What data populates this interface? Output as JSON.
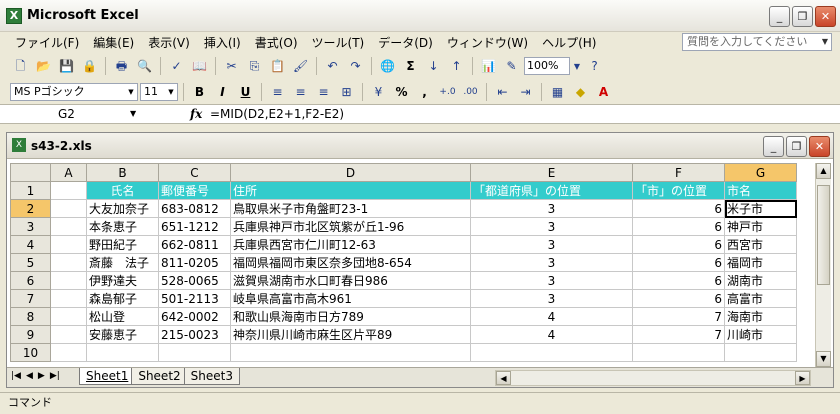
{
  "app": {
    "title": "Microsoft Excel",
    "icon": "excel-icon"
  },
  "menu": [
    "ファイル(F)",
    "編集(E)",
    "表示(V)",
    "挿入(I)",
    "書式(O)",
    "ツール(T)",
    "データ(D)",
    "ウィンドウ(W)",
    "ヘルプ(H)"
  ],
  "help_box": {
    "placeholder": "質問を入力してください"
  },
  "toolbar": {
    "zoom": "100%",
    "font": "MS Pゴシック",
    "size": "11",
    "bold": "B",
    "italic": "I",
    "underline": "U",
    "percent": "%",
    "comma": ",",
    "sigma": "Σ"
  },
  "formula": {
    "namebox": "G2",
    "fx": "fx",
    "value": "=MID(D2,E2+1,F2-E2)"
  },
  "workbook": {
    "name": "s43-2.xls"
  },
  "columns": [
    "A",
    "B",
    "C",
    "D",
    "E",
    "F",
    "G"
  ],
  "header_row": {
    "b": "氏名",
    "c": "郵便番号",
    "d": "住所",
    "e": "「都道府県」の位置",
    "f": "「市」の位置",
    "g": "市名"
  },
  "rows": [
    {
      "n": "2",
      "b": "大友加奈子",
      "c": "683-0812",
      "d": "鳥取県米子市角盤町23-1",
      "e": "3",
      "f": "6",
      "g": "米子市"
    },
    {
      "n": "3",
      "b": "本条恵子",
      "c": "651-1212",
      "d": "兵庫県神戸市北区筑紫が丘1-96",
      "e": "3",
      "f": "6",
      "g": "神戸市"
    },
    {
      "n": "4",
      "b": "野田紀子",
      "c": "662-0811",
      "d": "兵庫県西宮市仁川町12-63",
      "e": "3",
      "f": "6",
      "g": "西宮市"
    },
    {
      "n": "5",
      "b": "斎藤　法子",
      "c": "811-0205",
      "d": "福岡県福岡市東区奈多団地8-654",
      "e": "3",
      "f": "6",
      "g": "福岡市"
    },
    {
      "n": "6",
      "b": "伊野達夫",
      "c": "528-0065",
      "d": "滋賀県湖南市水口町春日986",
      "e": "3",
      "f": "6",
      "g": "湖南市"
    },
    {
      "n": "7",
      "b": "森島郁子",
      "c": "501-2113",
      "d": "岐阜県高富市高木961",
      "e": "3",
      "f": "6",
      "g": "高富市"
    },
    {
      "n": "8",
      "b": "松山登",
      "c": "642-0002",
      "d": "和歌山県海南市日方789",
      "e": "4",
      "f": "7",
      "g": "海南市"
    },
    {
      "n": "9",
      "b": "安藤恵子",
      "c": "215-0023",
      "d": "神奈川県川崎市麻生区片平89",
      "e": "4",
      "f": "7",
      "g": "川崎市"
    }
  ],
  "row_numbers": {
    "first": "1",
    "last": "10"
  },
  "sheets": [
    "Sheet1",
    "Sheet2",
    "Sheet3"
  ],
  "status": "コマンド",
  "colors": {
    "header_fill": "#33cccc",
    "selection": "#f5c66a"
  }
}
